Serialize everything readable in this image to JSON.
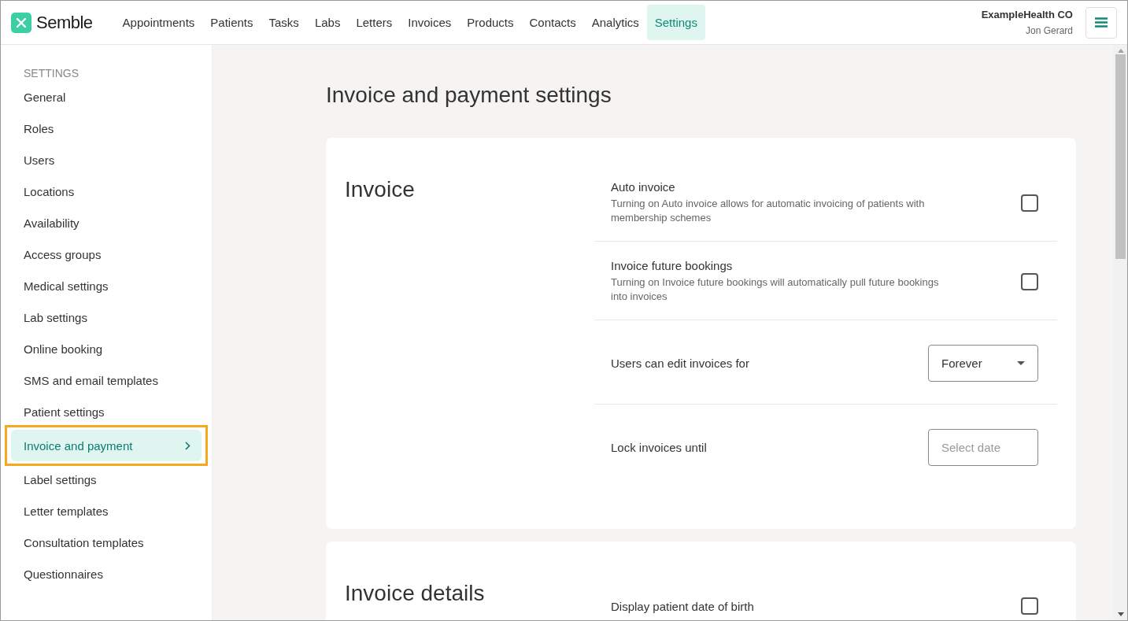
{
  "header": {
    "brand": "Semble",
    "nav": [
      {
        "label": "Appointments",
        "selected": false
      },
      {
        "label": "Patients",
        "selected": false
      },
      {
        "label": "Tasks",
        "selected": false
      },
      {
        "label": "Labs",
        "selected": false
      },
      {
        "label": "Letters",
        "selected": false
      },
      {
        "label": "Invoices",
        "selected": false
      },
      {
        "label": "Products",
        "selected": false
      },
      {
        "label": "Contacts",
        "selected": false
      },
      {
        "label": "Analytics",
        "selected": false
      },
      {
        "label": "Settings",
        "selected": true
      }
    ],
    "organization": "ExampleHealth CO",
    "user": "Jon Gerard"
  },
  "sidebar": {
    "heading": "SETTINGS",
    "items": [
      {
        "label": "General",
        "selected": false,
        "highlighted": false
      },
      {
        "label": "Roles",
        "selected": false,
        "highlighted": false
      },
      {
        "label": "Users",
        "selected": false,
        "highlighted": false
      },
      {
        "label": "Locations",
        "selected": false,
        "highlighted": false
      },
      {
        "label": "Availability",
        "selected": false,
        "highlighted": false
      },
      {
        "label": "Access groups",
        "selected": false,
        "highlighted": false
      },
      {
        "label": "Medical settings",
        "selected": false,
        "highlighted": false
      },
      {
        "label": "Lab settings",
        "selected": false,
        "highlighted": false
      },
      {
        "label": "Online booking",
        "selected": false,
        "highlighted": false
      },
      {
        "label": "SMS and email templates",
        "selected": false,
        "highlighted": false
      },
      {
        "label": "Patient settings",
        "selected": false,
        "highlighted": false
      },
      {
        "label": "Invoice and payment",
        "selected": true,
        "highlighted": true
      },
      {
        "label": "Label settings",
        "selected": false,
        "highlighted": false
      },
      {
        "label": "Letter templates",
        "selected": false,
        "highlighted": false
      },
      {
        "label": "Consultation templates",
        "selected": false,
        "highlighted": false
      },
      {
        "label": "Questionnaires",
        "selected": false,
        "highlighted": false
      }
    ]
  },
  "page_title": "Invoice and payment settings",
  "sections": [
    {
      "title": "Invoice",
      "rows": [
        {
          "kind": "checkbox",
          "label": "Auto invoice",
          "description": "Turning on Auto invoice allows for automatic invoicing of patients with membership schemes",
          "checked": false
        },
        {
          "kind": "checkbox",
          "label": "Invoice future bookings",
          "description": "Turning on Invoice future bookings will automatically pull future bookings into invoices",
          "checked": false
        },
        {
          "kind": "select",
          "label": "Users can edit invoices for",
          "value": "Forever"
        },
        {
          "kind": "date",
          "label": "Lock invoices until",
          "placeholder": "Select date"
        }
      ]
    },
    {
      "title": "Invoice details",
      "rows": [
        {
          "kind": "checkbox",
          "label": "Display patient date of birth",
          "checked": false
        }
      ]
    }
  ]
}
